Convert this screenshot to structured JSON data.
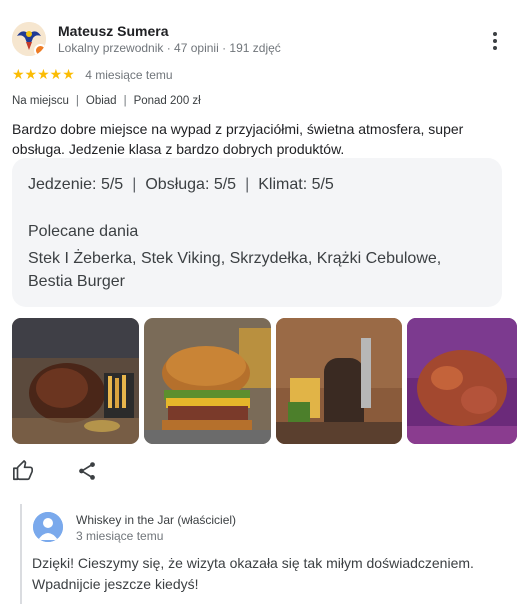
{
  "review": {
    "author_name": "Mateusz Sumera",
    "author_meta": "Lokalny przewodnik · 47 opinii · 191 zdjęć",
    "stars": "★★★★★",
    "rating": 5,
    "time": "4 miesiące temu",
    "tags": [
      "Na miejscu",
      "Obiad",
      "Ponad 200 zł"
    ],
    "text": "Bardzo dobre miejsce na wypad z przyjaciółmi, świetna atmosfera, super obsługa. Jedzenie klasa z bardzo dobrych produktów.",
    "aspects": [
      "Jedzenie: 5/5",
      "Obsługa: 5/5",
      "Klimat: 5/5"
    ],
    "dishes_title": "Polecane dania",
    "dishes": "Stek I Żeberka, Stek Viking, Skrzydełka, Krążki Cebulowe, Bestia Burger"
  },
  "actions": {
    "like_icon": "thumb-up-icon",
    "share_icon": "share-icon",
    "more_icon": "more-vertical-icon"
  },
  "owner_reply": {
    "name": "Whiskey in the Jar (właściciel)",
    "time": "3 miesiące temu",
    "text": "Dzięki! Cieszymy się, że wizyta okazała się tak miłym doświadczeniem. Wpadnijcie jeszcze kiedyś!"
  },
  "colors": {
    "star": "#fbbc04",
    "secondary_text": "#70757a",
    "box_background": "#f4f5f7"
  }
}
